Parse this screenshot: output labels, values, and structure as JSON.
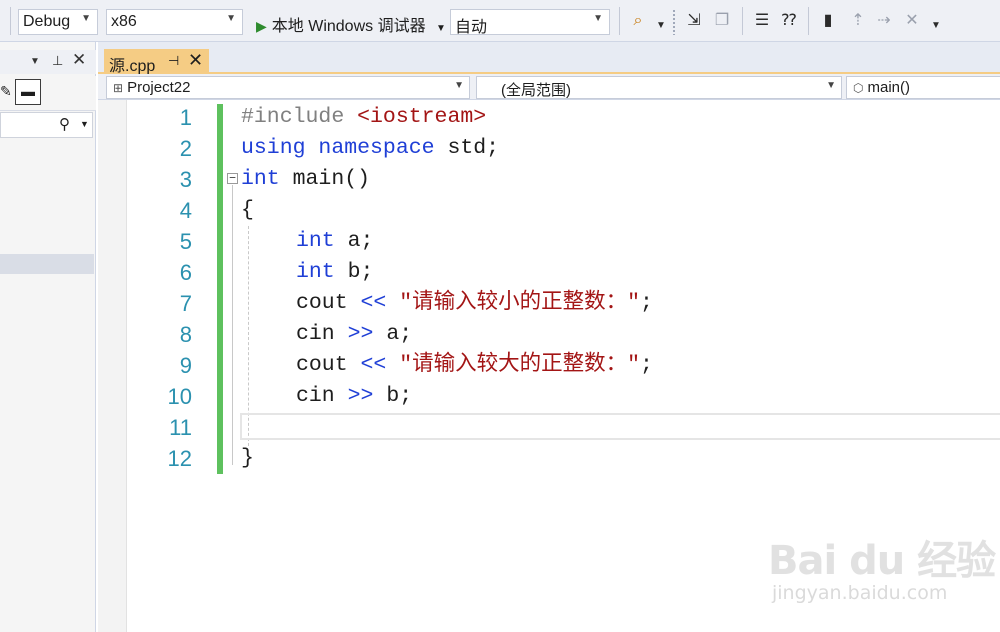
{
  "toolbar": {
    "config": "Debug",
    "platform": "x86",
    "debugger": "本地 Windows 调试器",
    "debugger_mode": "自动"
  },
  "tab": {
    "file": "源.cpp"
  },
  "navbar": {
    "project": "Project22",
    "scope": "(全局范围)",
    "member": "main()"
  },
  "line_numbers": [
    "1",
    "2",
    "3",
    "4",
    "5",
    "6",
    "7",
    "8",
    "9",
    "10",
    "11",
    "12"
  ],
  "code": {
    "l1_pp": "#include ",
    "l1_inc": "<iostream>",
    "l2_kw1": "using",
    "l2_kw2": "namespace",
    "l2_rest": " std;",
    "l3_kw": "int",
    "l3_rest": " main()",
    "l4": "{",
    "l5_kw": "int",
    "l5_rest": " a;",
    "l6_kw": "int",
    "l6_rest": " b;",
    "l7_a": "cout ",
    "l7_op": "<<",
    "l7_str": "\"请输入较小的正整数：\"",
    "l7_end": ";",
    "l8_a": "cin ",
    "l8_op": ">>",
    "l8_rest": " a;",
    "l9_a": "cout ",
    "l9_op": "<<",
    "l9_str": "\"请输入较大的正整数：\"",
    "l9_end": ";",
    "l10_a": "cin ",
    "l10_op": ">>",
    "l10_rest": " b;",
    "l12": "}"
  },
  "watermark": {
    "main": "Bai du 经验",
    "sub": "jingyan.baidu.com"
  },
  "colors": {
    "keyword": "#1f3fd6",
    "string": "#a31515",
    "line_number": "#2b91af",
    "change_bar": "#5ec15e",
    "tab_active": "#f5cc84"
  }
}
